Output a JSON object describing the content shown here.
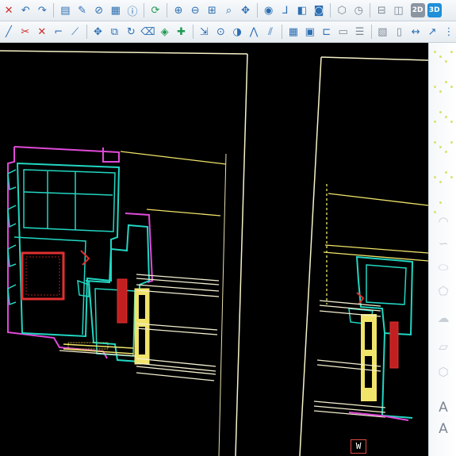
{
  "toolbar_top": {
    "buttons": [
      {
        "name": "delete-icon",
        "glyph": "✕"
      },
      {
        "name": "undo-icon",
        "glyph": "↶"
      },
      {
        "name": "redo-icon",
        "glyph": "↷"
      },
      {
        "name": "properties-icon",
        "glyph": "▤"
      },
      {
        "name": "edit-icon",
        "glyph": "✎"
      },
      {
        "name": "format-painter-icon",
        "glyph": "⊘"
      },
      {
        "name": "notes-icon",
        "glyph": "▦"
      },
      {
        "name": "info-icon",
        "glyph": "ⓘ"
      },
      {
        "name": "regenerate-icon",
        "glyph": "⟳"
      },
      {
        "name": "zoom-in-icon",
        "glyph": "⊕"
      },
      {
        "name": "zoom-out-icon",
        "glyph": "⊖"
      },
      {
        "name": "zoom-window-icon",
        "glyph": "⊞"
      },
      {
        "name": "zoom-extents-icon",
        "glyph": "⌕"
      },
      {
        "name": "pan-icon",
        "glyph": "✥"
      },
      {
        "name": "view-icon",
        "glyph": "◉"
      },
      {
        "name": "ucs-icon",
        "glyph": "⅃"
      },
      {
        "name": "named-views-icon",
        "glyph": "◧"
      },
      {
        "name": "render-icon",
        "glyph": "◙"
      },
      {
        "name": "box-3d-icon",
        "glyph": "⬡"
      },
      {
        "name": "orbit-icon",
        "glyph": "◷"
      },
      {
        "name": "viewports-icon",
        "glyph": "⊟"
      },
      {
        "name": "layout-icon",
        "glyph": "◫"
      }
    ],
    "view_2d_label": "2D",
    "view_3d_label": "3D"
  },
  "toolbar_bottom": {
    "buttons": [
      {
        "name": "line-icon",
        "glyph": "╱"
      },
      {
        "name": "trim-icon",
        "glyph": "✂"
      },
      {
        "name": "close-x-icon",
        "glyph": "✕"
      },
      {
        "name": "polyline-icon",
        "glyph": "⌐"
      },
      {
        "name": "slope-icon",
        "glyph": "⟋"
      },
      {
        "name": "move-icon",
        "glyph": "✥"
      },
      {
        "name": "copy-icon",
        "glyph": "⧉"
      },
      {
        "name": "rotate-icon",
        "glyph": "↻"
      },
      {
        "name": "erase-icon",
        "glyph": "⌫"
      },
      {
        "name": "fill-icon",
        "glyph": "◈"
      },
      {
        "name": "pick-point-icon",
        "glyph": "✚"
      },
      {
        "name": "snap-icon",
        "glyph": "⇲"
      },
      {
        "name": "center-icon",
        "glyph": "⊙"
      },
      {
        "name": "quadrant-icon",
        "glyph": "◑"
      },
      {
        "name": "mirror-icon",
        "glyph": "⋀"
      },
      {
        "name": "offset-icon",
        "glyph": "⫽"
      },
      {
        "name": "array-icon",
        "glyph": "▦"
      },
      {
        "name": "block-icon",
        "glyph": "▣"
      },
      {
        "name": "insert-icon",
        "glyph": "⊏"
      },
      {
        "name": "attribute-icon",
        "glyph": "▭"
      },
      {
        "name": "table-icon",
        "glyph": "☰"
      },
      {
        "name": "hatch-icon",
        "glyph": "▧"
      },
      {
        "name": "region-icon",
        "glyph": "▯"
      },
      {
        "name": "dimension-icon",
        "glyph": "↔"
      },
      {
        "name": "leader-icon",
        "glyph": "↗"
      },
      {
        "name": "grip-icon",
        "glyph": "⋮"
      }
    ]
  },
  "palette": {
    "icons": [
      {
        "name": "arc-icon",
        "glyph": "◠"
      },
      {
        "name": "spline-icon",
        "glyph": "∽"
      },
      {
        "name": "ellipse-icon",
        "glyph": "⬭"
      },
      {
        "name": "polygon-icon",
        "glyph": "⬠"
      },
      {
        "name": "revcloud-icon",
        "glyph": "☁"
      },
      {
        "name": "wipeout-icon",
        "glyph": "▱"
      },
      {
        "name": "boundary-icon",
        "glyph": "⬡"
      },
      {
        "name": "text-icon",
        "glyph": "A"
      },
      {
        "name": "mtext-icon",
        "glyph": "A"
      }
    ]
  },
  "drawing": {
    "label_w": "W"
  },
  "colors": {
    "cyan": "#22d6c2",
    "magenta": "#e04ad8",
    "yellow": "#f1e46a",
    "red": "#e03030",
    "white": "#f2f2f2",
    "frame": "#f6f2c8"
  }
}
